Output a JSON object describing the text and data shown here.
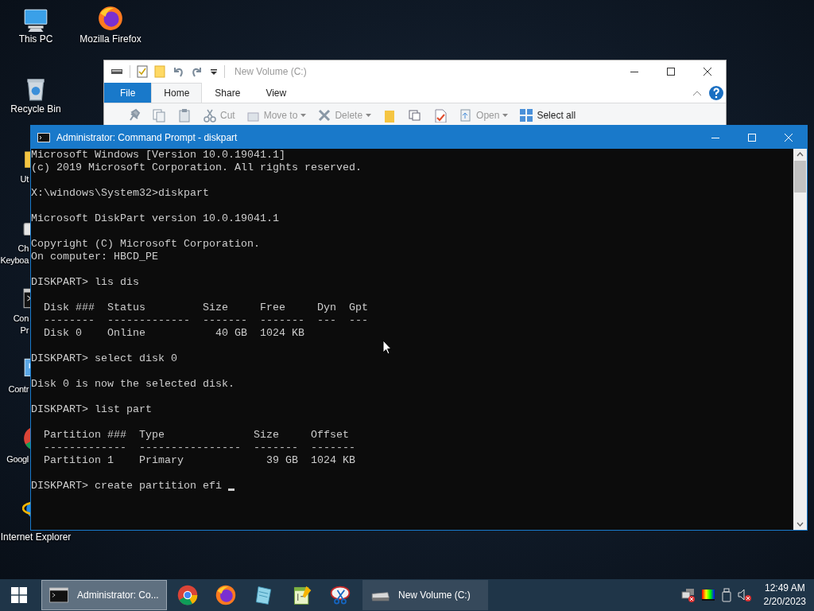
{
  "desktop": {
    "icons": [
      {
        "kind": "pc",
        "lines": [
          "This PC"
        ]
      },
      {
        "kind": "firefox",
        "lines": [
          "Mozilla Firefox"
        ]
      },
      {
        "kind": "recycle",
        "lines": [
          "Recycle Bin"
        ]
      },
      {
        "kind": "folder",
        "lines": [
          "Ut"
        ]
      },
      {
        "kind": "keyboard",
        "lines": [
          "Ch",
          "Keyboa"
        ]
      },
      {
        "kind": "cmd",
        "lines": [
          "Con",
          "Pr"
        ]
      },
      {
        "kind": "control",
        "lines": [
          "Contr"
        ]
      },
      {
        "kind": "chrome",
        "lines": [
          "Googl"
        ]
      },
      {
        "kind": "ie",
        "lines": [
          "Internet Explorer"
        ]
      }
    ]
  },
  "explorer": {
    "title": "New Volume (C:)",
    "tabs": [
      {
        "label": "File",
        "kind": "file",
        "selected": false
      },
      {
        "label": "Home",
        "kind": "tab",
        "selected": true
      },
      {
        "label": "Share",
        "kind": "tab",
        "selected": false
      },
      {
        "label": "View",
        "kind": "tab",
        "selected": false
      }
    ],
    "ribbon": [
      {
        "kind": "pin"
      },
      {
        "kind": "copy"
      },
      {
        "kind": "paste"
      },
      {
        "kind": "cut",
        "label": "Cut",
        "disabled": true,
        "dropdown": false
      },
      {
        "kind": "move",
        "label": "Move to",
        "disabled": true,
        "dropdown": true
      },
      {
        "kind": "delete",
        "label": "Delete",
        "disabled": true,
        "dropdown": true
      },
      {
        "kind": "newfolder"
      },
      {
        "kind": "newitem"
      },
      {
        "kind": "properties"
      },
      {
        "kind": "open",
        "label": "Open",
        "disabled": true,
        "dropdown": true
      },
      {
        "kind": "selectall",
        "label": "Select all",
        "disabled": false,
        "dropdown": false
      }
    ]
  },
  "console": {
    "title": "Administrator: Command Prompt - diskpart",
    "blocks": [
      [
        "Microsoft Windows [Version 10.0.19041.1]",
        "(c) 2019 Microsoft Corporation. All rights reserved."
      ],
      [
        "X:\\windows\\System32>diskpart"
      ],
      [
        "Microsoft DiskPart version 10.0.19041.1"
      ],
      [
        "Copyright (C) Microsoft Corporation.",
        "On computer: HBCD_PE"
      ],
      [
        "DISKPART> lis dis"
      ],
      [
        "  Disk ###  Status         Size     Free     Dyn  Gpt",
        "  --------  -------------  -------  -------  ---  ---",
        "  Disk 0    Online           40 GB  1024 KB"
      ],
      [
        "DISKPART> select disk 0"
      ],
      [
        "Disk 0 is now the selected disk."
      ],
      [
        "DISKPART> list part"
      ],
      [
        "  Partition ###  Type              Size     Offset",
        "  -------------  ----------------  -------  -------",
        "  Partition 1    Primary             39 GB  1024 KB"
      ],
      [
        "DISKPART> create partition efi "
      ]
    ]
  },
  "taskbar": {
    "items": [
      {
        "kind": "cmd",
        "label": "Administrator: Co...",
        "selected": true
      },
      {
        "kind": "chrome"
      },
      {
        "kind": "firefox"
      },
      {
        "kind": "notepad"
      },
      {
        "kind": "notepadpp"
      },
      {
        "kind": "snip"
      },
      {
        "kind": "drive",
        "label": "New Volume (C:)",
        "selected": false
      }
    ],
    "time": "12:49 AM",
    "date": "2/20/2023"
  }
}
